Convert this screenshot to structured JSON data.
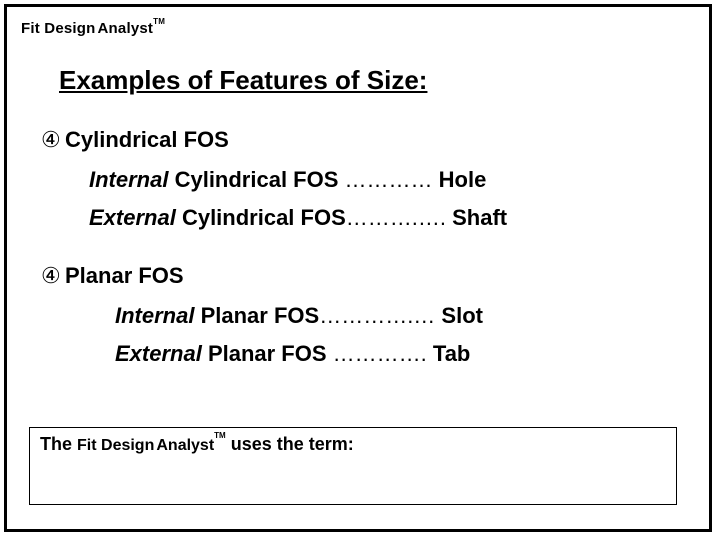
{
  "brand": {
    "part1": "Fit Design",
    "part2": "Analyst",
    "tm": "TM"
  },
  "title": "Examples of Features of Size:",
  "bullet_glyph": "④",
  "sections": [
    {
      "heading": "Cylindrical FOS",
      "items": [
        {
          "ital": "Internal",
          "rest": " Cylindrical FOS",
          "dots": " ………… ",
          "term": "Hole"
        },
        {
          "ital": "External",
          "rest": " Cylindrical FOS",
          "dots": "……….…. ",
          "term": "Shaft"
        }
      ]
    },
    {
      "heading": "Planar FOS",
      "items": [
        {
          "ital": "Internal",
          "rest": " Planar FOS",
          "dots": "………….… ",
          "term": "Slot"
        },
        {
          "ital": "External",
          "rest": " Planar FOS",
          "dots": " …………. ",
          "term": "Tab"
        }
      ]
    }
  ],
  "footer": {
    "pre": "The ",
    "brand1": "Fit Design",
    "brand2": "Analyst",
    "tm": "TM",
    "post": " uses the term:"
  }
}
